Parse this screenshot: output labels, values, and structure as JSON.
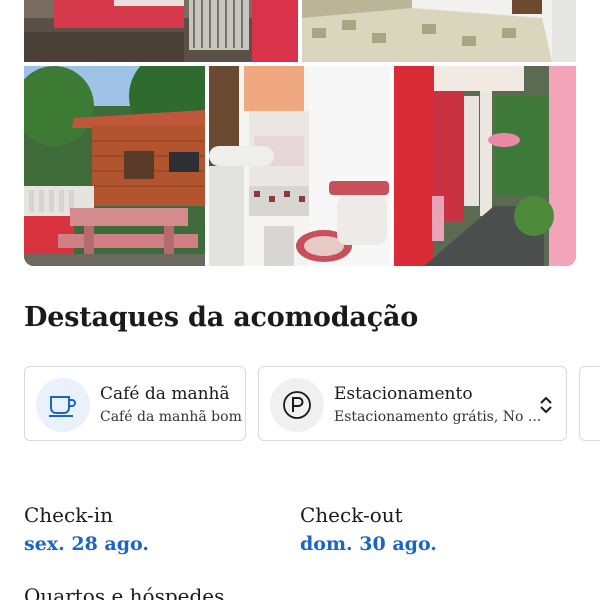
{
  "photos": [
    {
      "name": "exterior-gate",
      "alt_icon": "photo"
    },
    {
      "name": "bedroom-bed",
      "alt_icon": "photo"
    },
    {
      "name": "garden-picnic-table",
      "alt_icon": "photo"
    },
    {
      "name": "bathroom",
      "alt_icon": "photo"
    },
    {
      "name": "veranda-corridor",
      "alt_icon": "photo"
    }
  ],
  "highlights": {
    "title": "Destaques da acomodação",
    "items": [
      {
        "title": "Café da manhã",
        "subtitle": "Café da manhã bom",
        "icon": "coffee-cup-icon"
      },
      {
        "title": "Estacionamento",
        "subtitle": "Estacionamento grátis, No ...",
        "icon": "parking-icon"
      }
    ]
  },
  "stay": {
    "checkin_label": "Check-in",
    "checkin_date": "sex. 28 ago.",
    "checkout_label": "Check-out",
    "checkout_date": "dom. 30 ago.",
    "rooms_label": "Quartos e hóspedes"
  },
  "colors": {
    "accent": "#1a66c7",
    "icon_bg": "#eaf1fb"
  }
}
